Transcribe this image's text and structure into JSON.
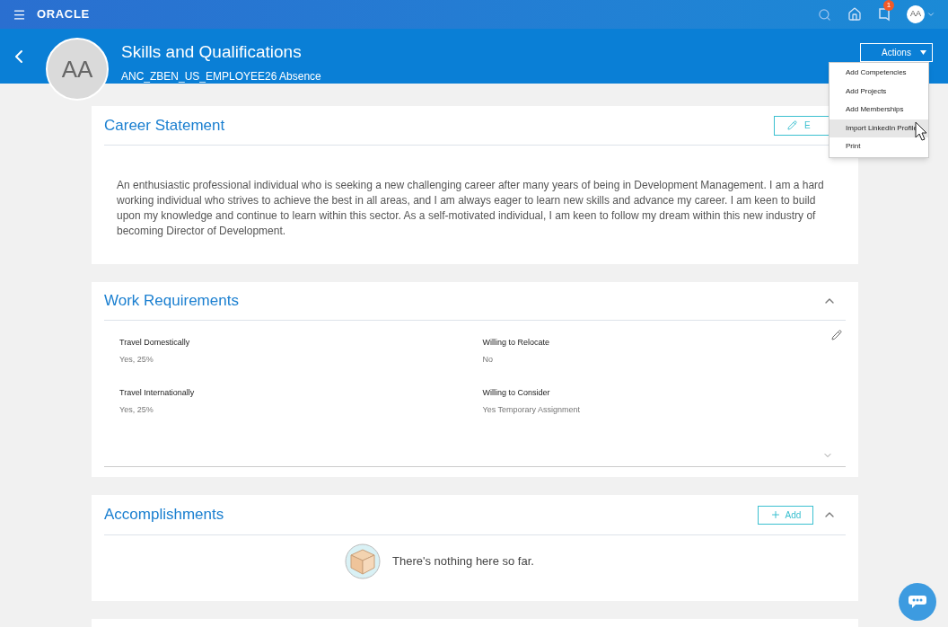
{
  "top_bar": {
    "logo": "ORACLE",
    "notification_count": "1",
    "user_initials": "AA"
  },
  "header": {
    "avatar_initials": "AA",
    "title": "Skills and Qualifications",
    "subtitle": "ANC_ZBEN_US_EMPLOYEE26 Absence",
    "actions_button": "Actions"
  },
  "actions_menu": [
    {
      "label": "Add Competencies",
      "selected": false
    },
    {
      "label": "Add Projects",
      "selected": false
    },
    {
      "label": "Add Memberships",
      "selected": false
    },
    {
      "label": "Import LinkedIn Profile",
      "selected": true
    },
    {
      "label": "Print",
      "selected": false
    }
  ],
  "career_statement": {
    "title": "Career Statement",
    "edit_button": "E",
    "text": "An enthusiastic professional individual who is seeking a new challenging career after many years of being in Development Management. I am a hard working individual who strives to achieve the best in all areas, and I am always eager to learn new skills and advance my career. I am keen to build upon my knowledge and continue to learn within this sector. As a self-motivated individual, I am keen to follow my dream within this new industry of becoming Director of Development."
  },
  "work_requirements": {
    "title": "Work Requirements",
    "fields": [
      {
        "label": "Travel Domestically",
        "value": "Yes, 25%"
      },
      {
        "label": "Willing to Relocate",
        "value": "No"
      },
      {
        "label": "Travel Internationally",
        "value": "Yes, 25%"
      },
      {
        "label": "Willing to Consider",
        "value": "Yes Temporary Assignment"
      }
    ]
  },
  "accomplishments": {
    "title": "Accomplishments",
    "add_button": "Add",
    "empty_message": "There's nothing here so far."
  }
}
